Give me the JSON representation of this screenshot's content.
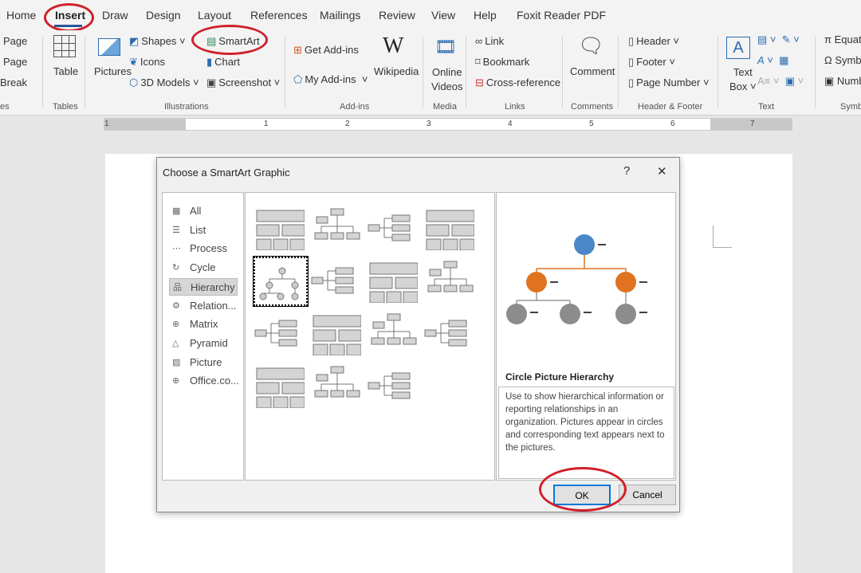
{
  "tabs": [
    "Home",
    "Insert",
    "Draw",
    "Design",
    "Layout",
    "References",
    "Mailings",
    "Review",
    "View",
    "Help",
    "Foxit Reader PDF"
  ],
  "ribbon": {
    "pages": [
      "Page",
      "Page",
      "Break"
    ],
    "pages_group": "es",
    "table": "Table",
    "tables_group": "Tables",
    "pictures": "Pictures",
    "shapes": "Shapes",
    "icons": "Icons",
    "models": "3D Models",
    "smartart": "SmartArt",
    "chart": "Chart",
    "screenshot": "Screenshot",
    "illustrations_group": "Illustrations",
    "get_addins": "Get Add-ins",
    "my_addins": "My Add-ins",
    "wikipedia": "Wikipedia",
    "addins_group": "Add-ins",
    "online": "Online",
    "videos": "Videos",
    "media_group": "Media",
    "link": "Link",
    "bookmark": "Bookmark",
    "crossref": "Cross-reference",
    "links_group": "Links",
    "comment": "Comment",
    "comments_group": "Comments",
    "header": "Header",
    "footer": "Footer",
    "page_number": "Page Number",
    "hf_group": "Header & Footer",
    "text": "Text",
    "box": "Box",
    "text_group": "Text",
    "equation": "Equat",
    "symbol": "Symb",
    "number": "Numb",
    "symbols_group": "Symb"
  },
  "ruler": [
    "1",
    "1",
    "2",
    "3",
    "4",
    "5",
    "6",
    "7"
  ],
  "dialog": {
    "title": "Choose a SmartArt Graphic",
    "help": "?",
    "close": "✕",
    "categories": [
      {
        "label": "All",
        "icon": "all-icon"
      },
      {
        "label": "List",
        "icon": "list-icon"
      },
      {
        "label": "Process",
        "icon": "process-icon"
      },
      {
        "label": "Cycle",
        "icon": "cycle-icon"
      },
      {
        "label": "Hierarchy",
        "icon": "hierarchy-icon",
        "selected": true
      },
      {
        "label": "Relation...",
        "icon": "relationship-icon"
      },
      {
        "label": "Matrix",
        "icon": "matrix-icon"
      },
      {
        "label": "Pyramid",
        "icon": "pyramid-icon"
      },
      {
        "label": "Picture",
        "icon": "picture-icon"
      },
      {
        "label": "Office.co...",
        "icon": "office-icon"
      }
    ],
    "selected_layout": "Circle Picture Hierarchy",
    "description": "Use to show hierarchical information or reporting relationships in an organization. Pictures appear in circles and corresponding text appears next to the pictures.",
    "ok": "OK",
    "cancel": "Cancel"
  },
  "colors": {
    "highlight": "#d0202a",
    "top_node": "#4a86c8",
    "mid_node": "#e0731f",
    "leaf_node": "#8c8c8c"
  }
}
